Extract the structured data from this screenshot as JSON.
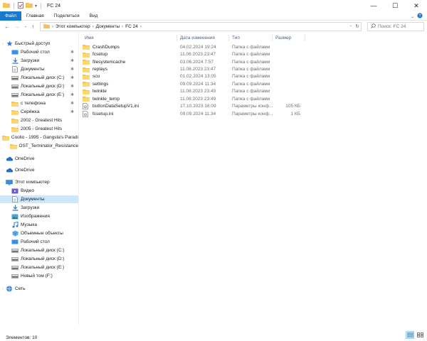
{
  "window": {
    "title": "FC 24",
    "minimize": "—",
    "maximize": "☐",
    "close": "✕"
  },
  "ribbon": {
    "tabs": [
      "Файл",
      "Главная",
      "Поделиться",
      "Вид"
    ]
  },
  "address": {
    "crumbs": [
      "Этот компьютер",
      "Документы",
      "FC 24"
    ],
    "search_placeholder": "Поиск: FC 24"
  },
  "columns": {
    "name": "Имя",
    "date": "Дата изменения",
    "type": "Тип",
    "size": "Размер"
  },
  "files": [
    {
      "name": "CrashDumps",
      "date": "04.02.2024 19:24",
      "type": "Папка с файлами",
      "size": "",
      "icon": "folder-icon"
    },
    {
      "name": "fcsetup",
      "date": "11.08.2023 23:47",
      "type": "Папка с файлами",
      "size": "",
      "icon": "folder-icon"
    },
    {
      "name": "filesystemcache",
      "date": "03.06.2024 7:57",
      "type": "Папка с файлами",
      "size": "",
      "icon": "folder-icon"
    },
    {
      "name": "replays",
      "date": "11.08.2023 23:47",
      "type": "Папка с файлами",
      "size": "",
      "icon": "folder-icon"
    },
    {
      "name": "scu",
      "date": "01.02.2024 13:05",
      "type": "Папка с файлами",
      "size": "",
      "icon": "folder-icon"
    },
    {
      "name": "settings",
      "date": "09.09.2024 11:34",
      "type": "Папка с файлами",
      "size": "",
      "icon": "folder-icon"
    },
    {
      "name": "twinkle",
      "date": "11.08.2023 23:49",
      "type": "Папка с файлами",
      "size": "",
      "icon": "folder-icon"
    },
    {
      "name": "twinkle_temp",
      "date": "11.08.2023 23:49",
      "type": "Папка с файлами",
      "size": "",
      "icon": "folder-icon"
    },
    {
      "name": "buttonDataSetupV1.ini",
      "date": "17.10.2023 16:09",
      "type": "Параметры конф...",
      "size": "105 КБ",
      "icon": "ini-file-icon"
    },
    {
      "name": "fcsetup.ini",
      "date": "09.09.2024 11:34",
      "type": "Параметры конф...",
      "size": "1 КБ",
      "icon": "ini-file-icon"
    }
  ],
  "sidebar": {
    "items": [
      {
        "label": "Быстрый доступ",
        "icon": "star-icon",
        "pinned": false,
        "level": 0,
        "selected": false
      },
      {
        "label": "Рабочий стол",
        "icon": "desktop-icon",
        "pinned": true,
        "level": 1,
        "selected": false
      },
      {
        "label": "Загрузки",
        "icon": "download-icon",
        "pinned": true,
        "level": 1,
        "selected": false
      },
      {
        "label": "Документы",
        "icon": "documents-icon",
        "pinned": true,
        "level": 1,
        "selected": false
      },
      {
        "label": "Локальный диск (C:)",
        "icon": "drive-icon",
        "pinned": true,
        "level": 1,
        "selected": false
      },
      {
        "label": "Локальный диск (D:)",
        "icon": "drive-icon",
        "pinned": true,
        "level": 1,
        "selected": false
      },
      {
        "label": "Локальный диск (E:)",
        "icon": "drive-icon",
        "pinned": true,
        "level": 1,
        "selected": false
      },
      {
        "label": "с телефона",
        "icon": "folder-icon",
        "pinned": true,
        "level": 1,
        "selected": false
      },
      {
        "label": "Серёжка",
        "icon": "folder-icon",
        "pinned": true,
        "level": 1,
        "selected": false
      },
      {
        "label": "2002 - Greatest Hits",
        "icon": "folder-icon",
        "pinned": false,
        "level": 1,
        "selected": false
      },
      {
        "label": "2005 - Greatest Hits",
        "icon": "folder-icon",
        "pinned": false,
        "level": 1,
        "selected": false
      },
      {
        "label": "Coolio - 1995 - Gangsta's Paradi",
        "icon": "folder-icon",
        "pinned": false,
        "level": 1,
        "selected": false
      },
      {
        "label": "OST_Terminator_Resistance",
        "icon": "folder-icon",
        "pinned": false,
        "level": 1,
        "selected": false
      },
      {
        "label": "OneDrive",
        "icon": "cloud-icon",
        "pinned": false,
        "level": 0,
        "selected": false
      },
      {
        "label": "OneDrive",
        "icon": "cloud-icon",
        "pinned": false,
        "level": 0,
        "selected": false
      },
      {
        "label": "Этот компьютер",
        "icon": "computer-icon",
        "pinned": false,
        "level": 0,
        "selected": false
      },
      {
        "label": "Видео",
        "icon": "video-icon",
        "pinned": false,
        "level": 1,
        "selected": false
      },
      {
        "label": "Документы",
        "icon": "documents-icon",
        "pinned": false,
        "level": 1,
        "selected": true
      },
      {
        "label": "Загрузки",
        "icon": "download-icon",
        "pinned": false,
        "level": 1,
        "selected": false
      },
      {
        "label": "Изображения",
        "icon": "pictures-icon",
        "pinned": false,
        "level": 1,
        "selected": false
      },
      {
        "label": "Музыка",
        "icon": "music-icon",
        "pinned": false,
        "level": 1,
        "selected": false
      },
      {
        "label": "Объемные объекты",
        "icon": "3d-objects-icon",
        "pinned": false,
        "level": 1,
        "selected": false
      },
      {
        "label": "Рабочий стол",
        "icon": "desktop-icon",
        "pinned": false,
        "level": 1,
        "selected": false
      },
      {
        "label": "Локальный диск (C:)",
        "icon": "drive-icon",
        "pinned": false,
        "level": 1,
        "selected": false
      },
      {
        "label": "Локальный диск (D:)",
        "icon": "drive-icon",
        "pinned": false,
        "level": 1,
        "selected": false
      },
      {
        "label": "Локальный диск (E:)",
        "icon": "drive-icon",
        "pinned": false,
        "level": 1,
        "selected": false
      },
      {
        "label": "Новый том (F:)",
        "icon": "drive-icon",
        "pinned": false,
        "level": 1,
        "selected": false
      },
      {
        "label": "Сеть",
        "icon": "network-icon",
        "pinned": false,
        "level": 0,
        "selected": false
      }
    ]
  },
  "status": {
    "items_count": "Элементов: 10"
  },
  "colors": {
    "accent": "#1979ca",
    "selection": "#cce8ff",
    "folder": "#f2c55c",
    "header_text": "#4d6082"
  }
}
